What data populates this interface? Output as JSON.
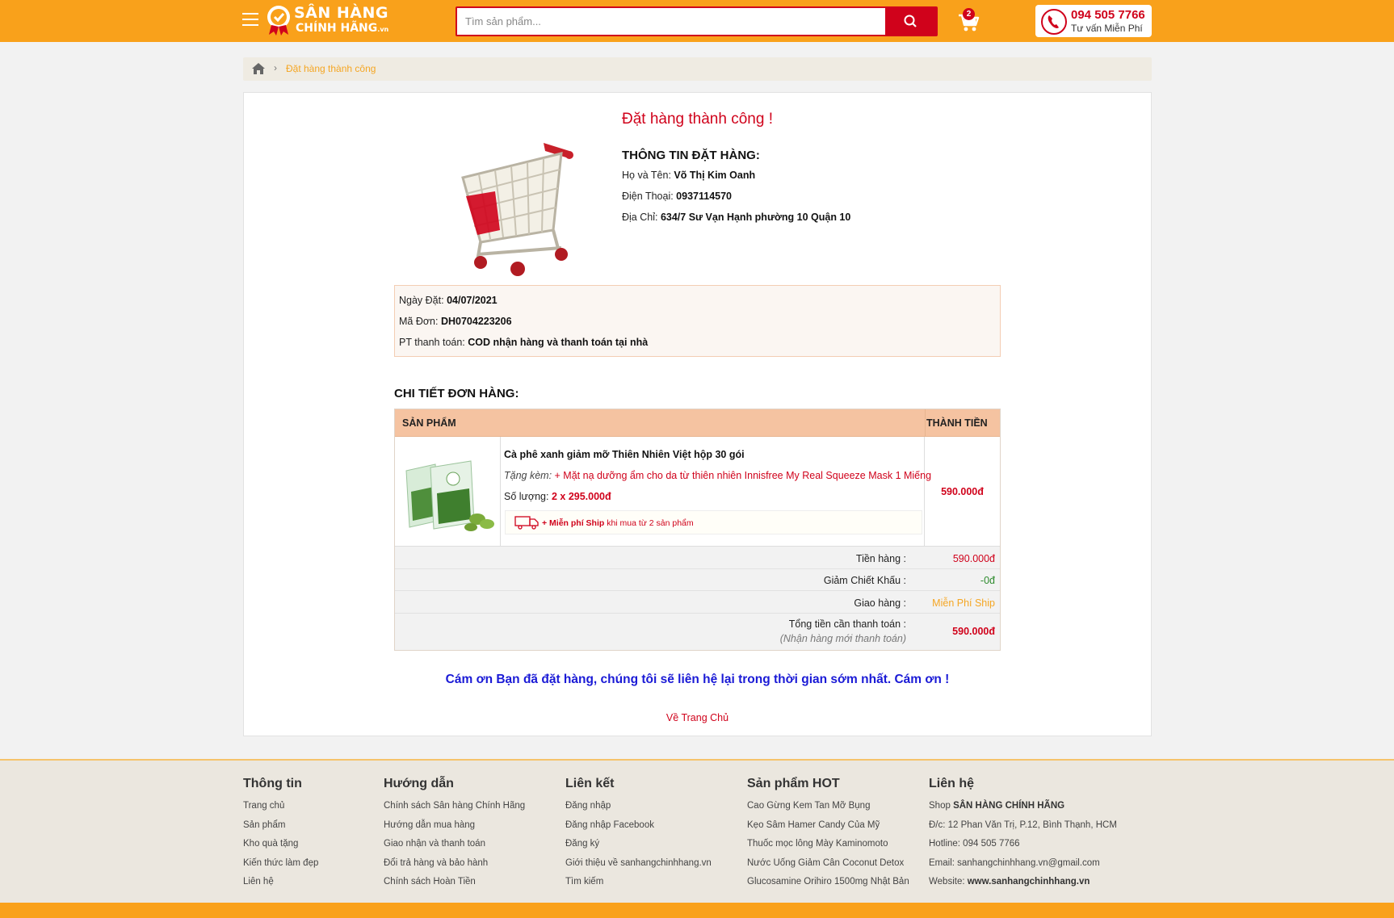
{
  "header": {
    "logo_line1": "SÂN HÀNG",
    "logo_line2": "CHÍNH HÃNG",
    "logo_suffix": ".vn",
    "search_placeholder": "Tìm sản phẩm...",
    "cart_count": "2",
    "hotline_number": "094 505 7766",
    "hotline_sub": "Tư vấn Miễn Phí"
  },
  "breadcrumb": {
    "separator": "›",
    "current": "Đặt hàng thành công"
  },
  "order": {
    "success_title": "Đặt hàng thành công !",
    "info_title": "THÔNG TIN ĐẶT HÀNG:",
    "name_label": "Họ và Tên: ",
    "name_value": "Võ Thị Kim Oanh",
    "phone_label": "Điện Thoại: ",
    "phone_value": "0937114570",
    "address_label": "Địa Chỉ: ",
    "address_value": "634/7 Sư Vạn Hạnh phường 10 Quận 10",
    "date_label": "Ngày Đặt: ",
    "date_value": "04/07/2021",
    "code_label": "Mã Đơn: ",
    "code_value": "DH0704223206",
    "payment_label": "PT thanh toán: ",
    "payment_value": "COD nhận hàng và thanh toán tại nhà"
  },
  "details": {
    "title": "CHI TIẾT ĐƠN HÀNG:",
    "col_product": "SẢN PHẨM",
    "col_total": "THÀNH TIỀN",
    "items": [
      {
        "name": "Cà phê xanh giảm mỡ Thiên Nhiên Việt hộp 30 gói",
        "gift_label": "Tặng kèm: ",
        "gift_value": "+ Mặt nạ dưỡng ẩm cho da từ thiên nhiên Innisfree My Real Squeeze Mask 1 Miếng",
        "qty_label": "Số lượng: ",
        "qty_value": "2 x 295.000đ",
        "ship_note_bold": "+ Miễn phí Ship",
        "ship_note_rest": " khi mua từ 2 sản phẩm",
        "total": "590.000đ"
      }
    ],
    "subtotal_label": "Tiền hàng :",
    "subtotal_value": "590.000đ",
    "discount_label": "Giảm Chiết Khấu :",
    "discount_value": "-0đ",
    "shipping_label": "Giao hàng :",
    "shipping_value": "Miễn Phí Ship",
    "grand_label": "Tổng tiền cần thanh toán :",
    "grand_note": "(Nhận hàng mới thanh toán)",
    "grand_value": "590.000đ"
  },
  "thanks_message": "Cám ơn Bạn đã đặt hàng, chúng tôi sẽ liên hệ lại trong thời gian sớm nhất. Cám ơn !",
  "home_link": "Về Trang Chủ",
  "footer": {
    "col1": {
      "title": "Thông tin",
      "items": [
        "Trang chủ",
        "Sản phẩm",
        "Kho quà tặng",
        "Kiến thức làm đẹp",
        "Liên hệ"
      ]
    },
    "col2": {
      "title": "Hướng dẫn",
      "items": [
        "Chính sách Sân hàng Chính Hãng",
        "Hướng dẫn mua hàng",
        "Giao nhận và thanh toán",
        "Đổi trả hàng và bảo hành",
        "Chính sách Hoàn Tiền"
      ]
    },
    "col3": {
      "title": "Liên kết",
      "items": [
        "Đăng nhập",
        "Đăng nhập Facebook",
        "Đăng ký",
        "Giới thiệu về sanhangchinhhang.vn",
        "Tìm kiếm"
      ]
    },
    "col4": {
      "title": "Sản phẩm HOT",
      "items": [
        "Cao Gừng Kem Tan Mỡ Bụng",
        "Kẹo Sâm Hamer Candy Của Mỹ",
        "Thuốc mọc lông Mày Kaminomoto",
        "Nước Uống Giảm Cân Coconut Detox",
        "Glucosamine Orihiro 1500mg Nhật Bản"
      ]
    },
    "col5": {
      "title": "Liên hệ",
      "shop_label": "Shop ",
      "shop_value": "SÂN HÀNG CHÍNH HÃNG",
      "address": "Đ/c: 12 Phan Văn Trị, P.12, Bình Thạnh, HCM",
      "hotline": "Hotline: 094 505 7766",
      "email": "Email: sanhangchinhhang.vn@gmail.com",
      "website_label": "Website: ",
      "website_value": "www.sanhangchinhhang.vn"
    }
  },
  "colors": {
    "brand_orange": "#f9a11b",
    "accent_red": "#d0021b",
    "thanks_blue": "#1a1ad6"
  }
}
